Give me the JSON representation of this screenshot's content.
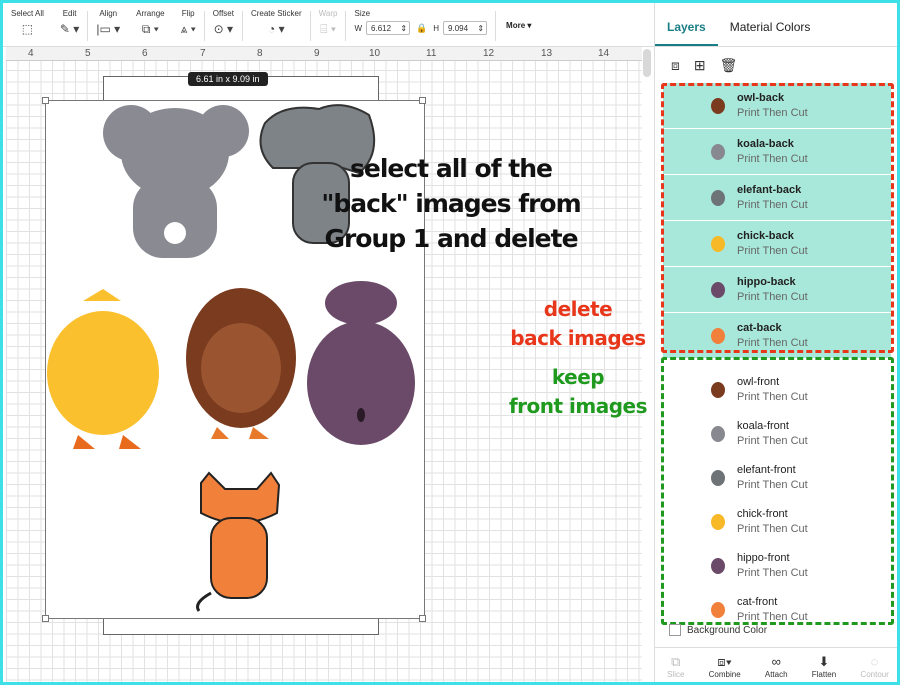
{
  "toolbar": {
    "select_all": "Select All",
    "edit": "Edit",
    "align": "Align",
    "arrange": "Arrange",
    "flip": "Flip",
    "offset": "Offset",
    "create_sticker": "Create Sticker",
    "warp": "Warp",
    "size": "Size",
    "w_label": "W",
    "w_value": "6.612",
    "h_label": "H",
    "h_value": "9.094",
    "more": "More"
  },
  "ruler": [
    "4",
    "5",
    "6",
    "7",
    "8",
    "9",
    "10",
    "11",
    "12",
    "13",
    "14"
  ],
  "canvas": {
    "dimension_label": "6.61  in x 9.09  in"
  },
  "annotations": {
    "main_line1": "select all of the",
    "main_line2": "\"back\" images from",
    "main_line3": "Group 1 and delete",
    "delete_line1": "delete",
    "delete_line2": "back images",
    "keep_line1": "keep",
    "keep_line2": "front images"
  },
  "panel": {
    "tab_layers": "Layers",
    "tab_material": "Material Colors",
    "layers": [
      {
        "name": "owl-back",
        "op": "Print Then Cut",
        "selected": true,
        "color": "#7a3b1f"
      },
      {
        "name": "koala-back",
        "op": "Print Then Cut",
        "selected": true,
        "color": "#888890"
      },
      {
        "name": "elefant-back",
        "op": "Print Then Cut",
        "selected": true,
        "color": "#6e7378"
      },
      {
        "name": "chick-back",
        "op": "Print Then Cut",
        "selected": true,
        "color": "#f7b928"
      },
      {
        "name": "hippo-back",
        "op": "Print Then Cut",
        "selected": true,
        "color": "#6a4a68"
      },
      {
        "name": "cat-back",
        "op": "Print Then Cut",
        "selected": true,
        "color": "#f0803a"
      },
      {
        "name": "owl-front",
        "op": "Print Then Cut",
        "selected": false,
        "color": "#7a3b1f"
      },
      {
        "name": "koala-front",
        "op": "Print Then Cut",
        "selected": false,
        "color": "#888890"
      },
      {
        "name": "elefant-front",
        "op": "Print Then Cut",
        "selected": false,
        "color": "#6e7378"
      },
      {
        "name": "chick-front",
        "op": "Print Then Cut",
        "selected": false,
        "color": "#f7b928"
      },
      {
        "name": "hippo-front",
        "op": "Print Then Cut",
        "selected": false,
        "color": "#6a4a68"
      },
      {
        "name": "cat-front",
        "op": "Print Then Cut",
        "selected": false,
        "color": "#f0803a"
      }
    ],
    "background_color": "Background Color",
    "bottom": {
      "slice": "Slice",
      "combine": "Combine",
      "attach": "Attach",
      "flatten": "Flatten",
      "contour": "Contour"
    }
  }
}
